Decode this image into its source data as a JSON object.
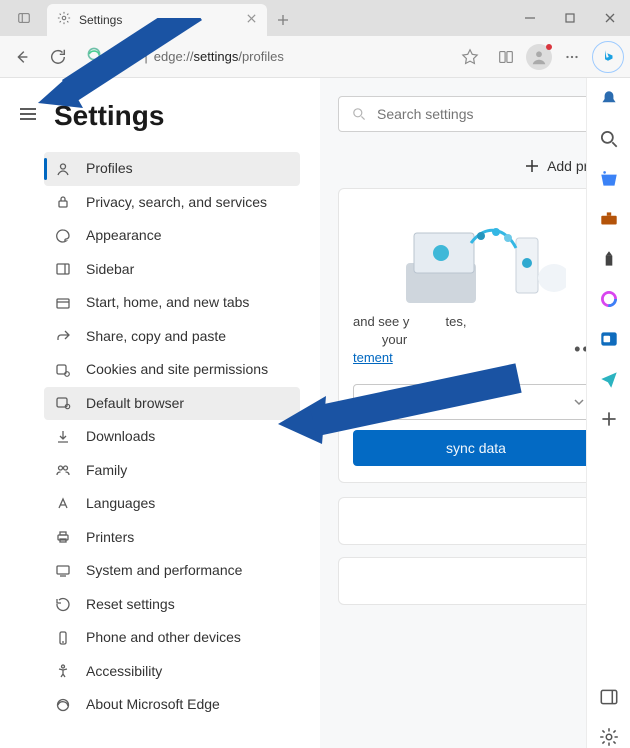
{
  "titlebar": {
    "tab_title": "Settings"
  },
  "toolbar": {
    "addr_label": "Edge",
    "addr_prefix": "edge://",
    "addr_highlight": "settings",
    "addr_suffix": "/profiles"
  },
  "nav": {
    "title": "Settings",
    "items": [
      {
        "id": "profiles",
        "label": "Profiles"
      },
      {
        "id": "privacy",
        "label": "Privacy, search, and services"
      },
      {
        "id": "appearance",
        "label": "Appearance"
      },
      {
        "id": "sidebar",
        "label": "Sidebar"
      },
      {
        "id": "start",
        "label": "Start, home, and new tabs"
      },
      {
        "id": "share",
        "label": "Share, copy and paste"
      },
      {
        "id": "cookies",
        "label": "Cookies and site permissions"
      },
      {
        "id": "default",
        "label": "Default browser"
      },
      {
        "id": "downloads",
        "label": "Downloads"
      },
      {
        "id": "family",
        "label": "Family"
      },
      {
        "id": "languages",
        "label": "Languages"
      },
      {
        "id": "printers",
        "label": "Printers"
      },
      {
        "id": "system",
        "label": "System and performance"
      },
      {
        "id": "reset",
        "label": "Reset settings"
      },
      {
        "id": "phone",
        "label": "Phone and other devices"
      },
      {
        "id": "accessibility",
        "label": "Accessibility"
      },
      {
        "id": "about",
        "label": "About Microsoft Edge"
      }
    ]
  },
  "main": {
    "search_placeholder": "Search settings",
    "add_profile": "Add profile",
    "card_text1": "and see y",
    "card_text2": "tes,",
    "card_text3": "your",
    "card_link": "tement",
    "sync_label": "sync data"
  }
}
